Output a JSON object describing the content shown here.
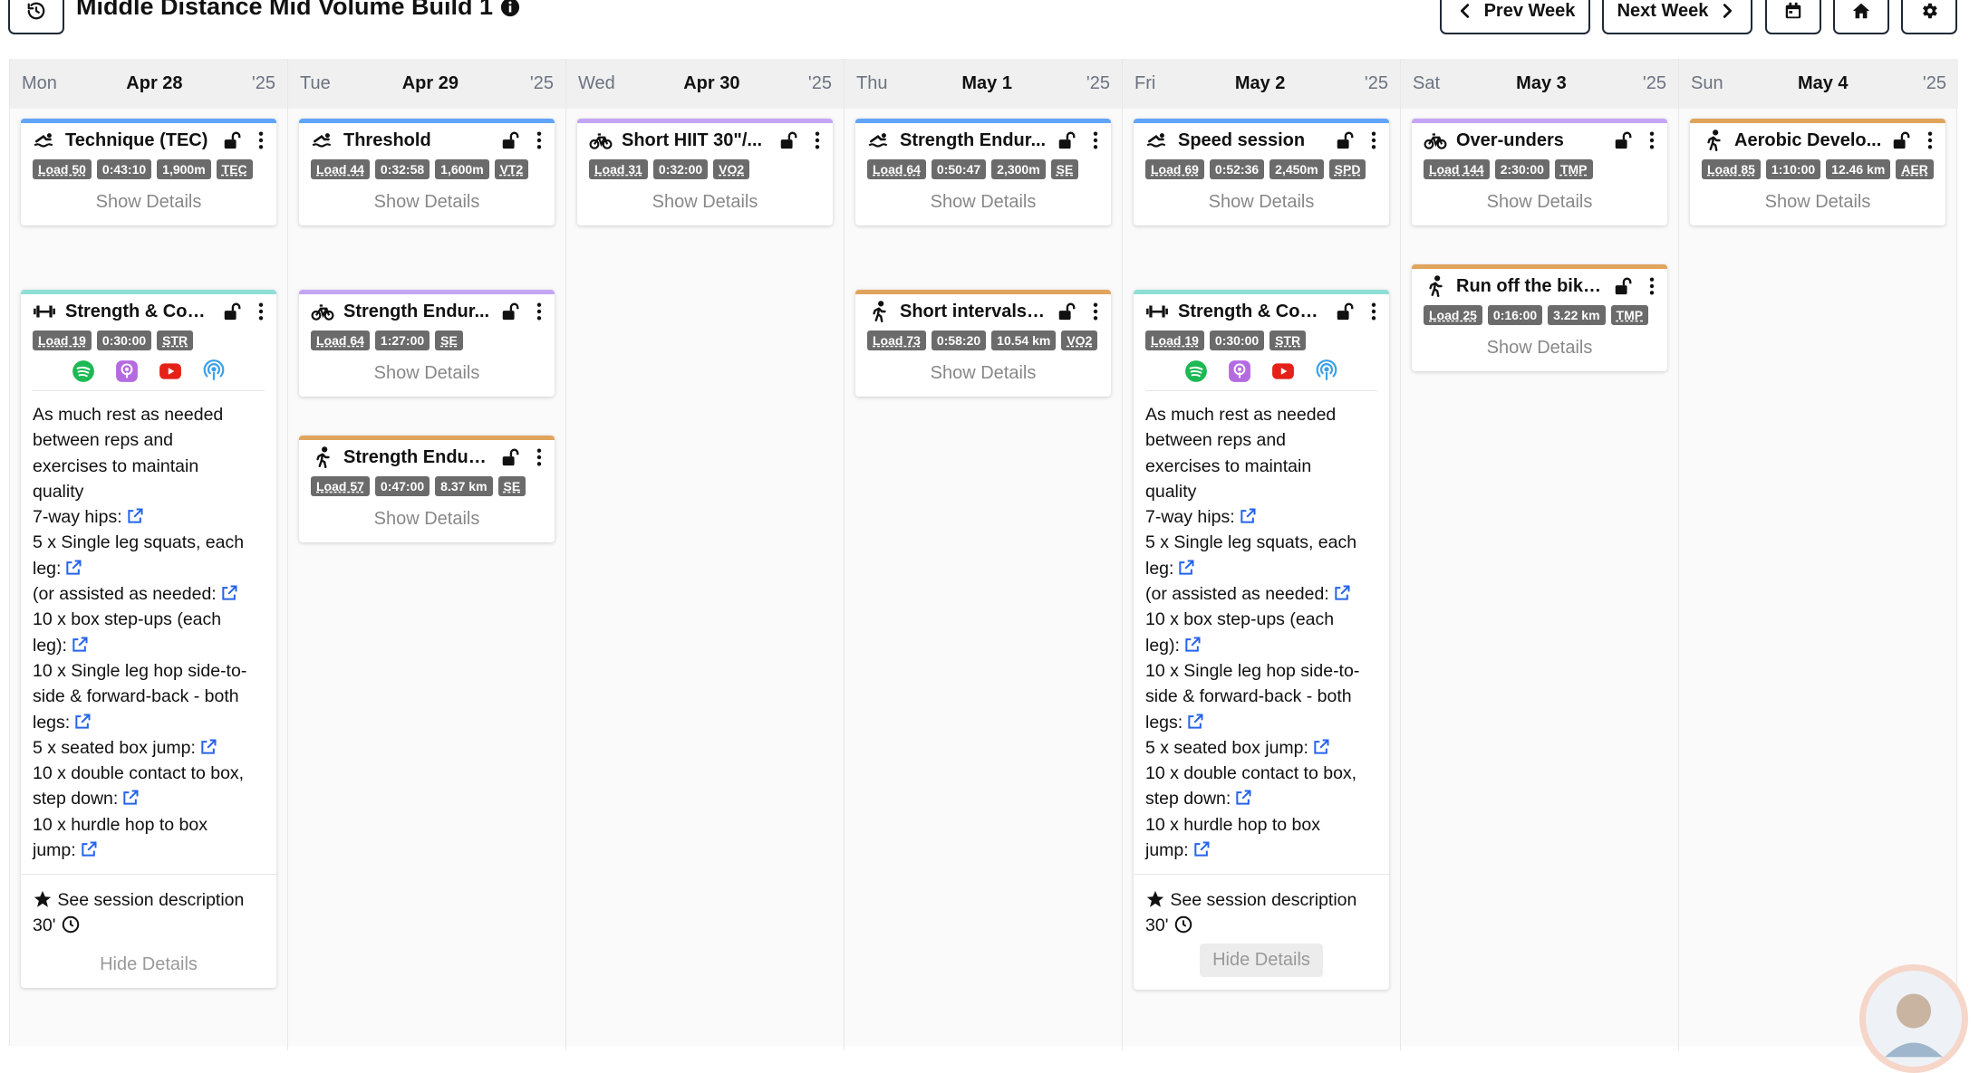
{
  "header": {
    "title": "Middle Distance Mid Volume Build 1",
    "prev_week": "Prev Week",
    "next_week": "Next Week"
  },
  "days": [
    {
      "dow": "Mon",
      "date": "Apr 28",
      "year": "'25"
    },
    {
      "dow": "Tue",
      "date": "Apr 29",
      "year": "'25"
    },
    {
      "dow": "Wed",
      "date": "Apr 30",
      "year": "'25"
    },
    {
      "dow": "Thu",
      "date": "May 1",
      "year": "'25"
    },
    {
      "dow": "Fri",
      "date": "May 2",
      "year": "'25"
    },
    {
      "dow": "Sat",
      "date": "May 3",
      "year": "'25"
    },
    {
      "dow": "Sun",
      "date": "May 4",
      "year": "'25"
    }
  ],
  "colors": {
    "swim": "#60a5fa",
    "bike": "#c4a5f5",
    "run": "#e0a45c",
    "strength": "#8ee0d6",
    "badge": "#6b6b6b",
    "link": "#2563eb"
  },
  "labels": {
    "show_details": "Show Details",
    "hide_details": "Hide Details"
  },
  "mon": {
    "c1": {
      "name": "Technique (TEC)",
      "load": "Load 50",
      "dur": "0:43:10",
      "dist": "1,900m",
      "zone": "TEC"
    },
    "c2": {
      "name": "Strength & Con...",
      "load": "Load 19",
      "dur": "0:30:00",
      "zone": "STR"
    }
  },
  "tue": {
    "c1": {
      "name": "Threshold",
      "load": "Load 44",
      "dur": "0:32:58",
      "dist": "1,600m",
      "zone": "VT2"
    },
    "c2": {
      "name": "Strength Endur...",
      "load": "Load 64",
      "dur": "1:27:00",
      "zone": "SE"
    },
    "c3": {
      "name": "Strength Endura...",
      "load": "Load 57",
      "dur": "0:47:00",
      "dist": "8.37 km",
      "zone": "SE"
    }
  },
  "wed": {
    "c1": {
      "name": "Short HIIT 30\"/...",
      "load": "Load 31",
      "dur": "0:32:00",
      "zone": "VO2"
    }
  },
  "thu": {
    "c1": {
      "name": "Strength Endur...",
      "load": "Load 64",
      "dur": "0:50:47",
      "dist": "2,300m",
      "zone": "SE"
    },
    "c2": {
      "name": "Short intervals -...",
      "load": "Load 73",
      "dur": "0:58:20",
      "dist": "10.54 km",
      "zone": "VO2"
    }
  },
  "fri": {
    "c1": {
      "name": "Speed session",
      "load": "Load 69",
      "dur": "0:52:36",
      "dist": "2,450m",
      "zone": "SPD"
    },
    "c2": {
      "name": "Strength & Con...",
      "load": "Load 19",
      "dur": "0:30:00",
      "zone": "STR"
    }
  },
  "sat": {
    "c1": {
      "name": "Over-unders",
      "load": "Load 144",
      "dur": "2:30:00",
      "zone": "TMP"
    },
    "c2": {
      "name": "Run off the bike ...",
      "load": "Load 25",
      "dur": "0:16:00",
      "dist": "3.22 km",
      "zone": "TMP"
    }
  },
  "sun": {
    "c1": {
      "name": "Aerobic Develo...",
      "load": "Load 85",
      "dur": "1:10:00",
      "dist": "12.46 km",
      "zone": "AER"
    }
  },
  "strength_desc": {
    "l1": "As much rest as needed",
    "l2": "between reps and",
    "l3": "exercises to maintain",
    "l4": "quality",
    "l5": "7-way hips:",
    "l6": "5 x Single leg squats, each",
    "l7": "leg:",
    "l8": "(or assisted as needed:",
    "l9": "10 x box step-ups (each",
    "l10": "leg):",
    "l11": "10 x Single leg hop side-to-",
    "l12": "side & forward-back - both",
    "l13": "legs:",
    "l14": "5 x seated box jump:",
    "l15": "10 x double contact to box,",
    "l16": "step down:",
    "l17": "10 x hurdle hop to box",
    "l18": "jump:",
    "see": "See session description",
    "dur": "30'"
  }
}
